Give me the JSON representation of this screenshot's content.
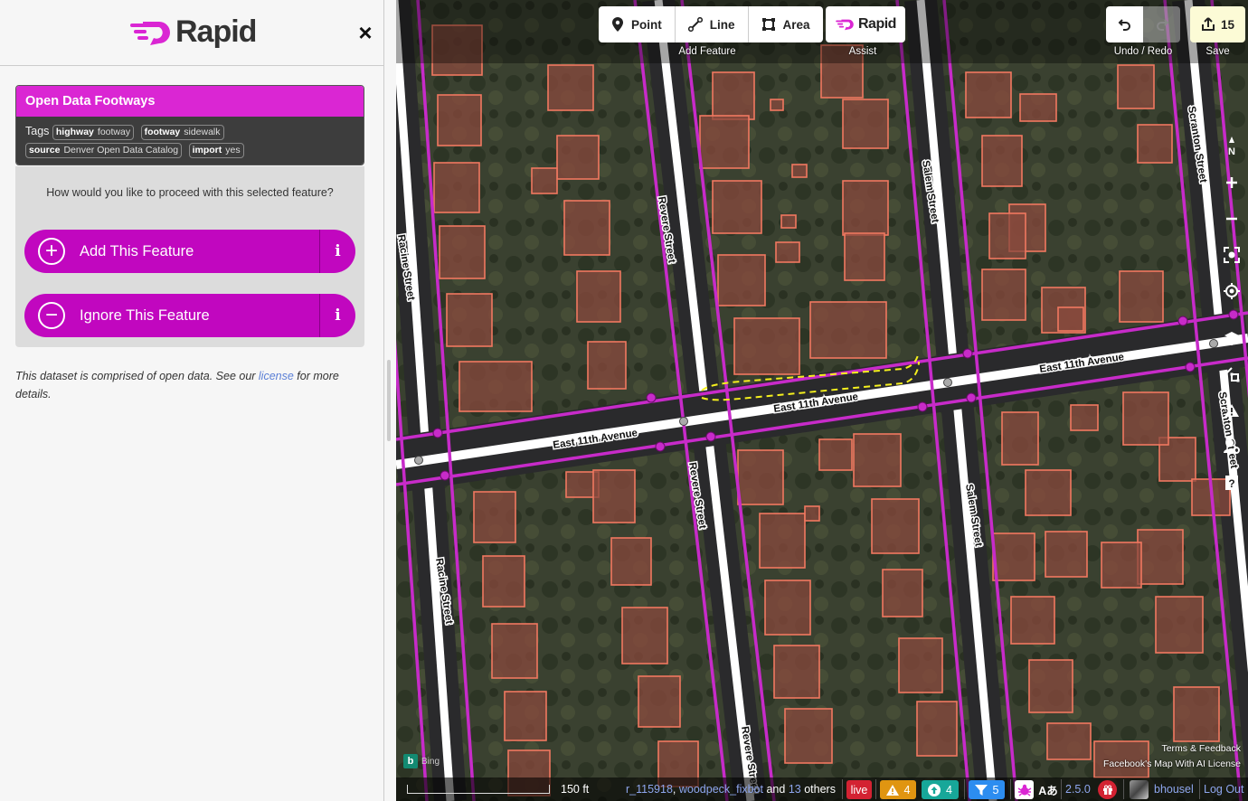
{
  "sidebar": {
    "logo_text": "Rapid",
    "close_label": "×",
    "feature": {
      "title": "Open Data Footways",
      "tags_label": "Tags",
      "tags": [
        {
          "key": "highway",
          "value": "footway"
        },
        {
          "key": "footway",
          "value": "sidewalk"
        },
        {
          "key": "source",
          "value": "Denver Open Data Catalog"
        },
        {
          "key": "import",
          "value": "yes"
        }
      ]
    },
    "prompt": "How would you like to proceed with this selected feature?",
    "add_button": {
      "label": "Add This Feature",
      "icon": "plus-circle-icon",
      "info": "i"
    },
    "ignore_button": {
      "label": "Ignore This Feature",
      "icon": "minus-circle-icon",
      "info": "i"
    },
    "note_before": "This dataset is comprised of open data. See our ",
    "note_link": "license",
    "note_after": " for more details."
  },
  "toolbar": {
    "add_feature": {
      "label": "Add Feature",
      "buttons": [
        {
          "label": "Point",
          "icon": "point-marker-icon"
        },
        {
          "label": "Line",
          "icon": "line-icon"
        },
        {
          "label": "Area",
          "icon": "area-icon"
        }
      ]
    },
    "assist": {
      "label": "Assist",
      "button_label": "Rapid"
    },
    "undo_redo_label": "Undo / Redo",
    "save": {
      "label": "Save",
      "count": "15"
    }
  },
  "map": {
    "streets": {
      "east_11th_1": "East 11th Avenue",
      "east_11th_2": "East 11th Avenue",
      "east_11th_3": "East 11th Avenue",
      "revere_1": "Revere Street",
      "revere_2": "Revere Street",
      "revere_3": "Revere Street",
      "salem_1": "Salem Street",
      "salem_2": "Salem Street",
      "racine_1": "Racine Street",
      "racine_2": "Racine Street",
      "scranton_1": "Scranton Street",
      "scranton_2": "Scranton Street"
    },
    "colors": {
      "sidewalk": "#c72bc9",
      "building": "#f07860",
      "selection": "#f5f01e",
      "road": "#ffffff"
    },
    "attribution": {
      "terms": "Terms & Feedback",
      "license": "Facebook's Map With AI License",
      "imagery": "Bing"
    }
  },
  "footer": {
    "scale": "150 ft",
    "contributors": [
      "r_115918",
      "woodpeck_fixbot"
    ],
    "and_text": "and",
    "others_count": "13",
    "others_text": "others",
    "live_label": "live",
    "warnings_count": "4",
    "uploads_count": "4",
    "filters_count": "5",
    "version": "2.5.0",
    "username": "bhousel",
    "logout": "Log Out",
    "lang_icon_text": "Aあ"
  }
}
